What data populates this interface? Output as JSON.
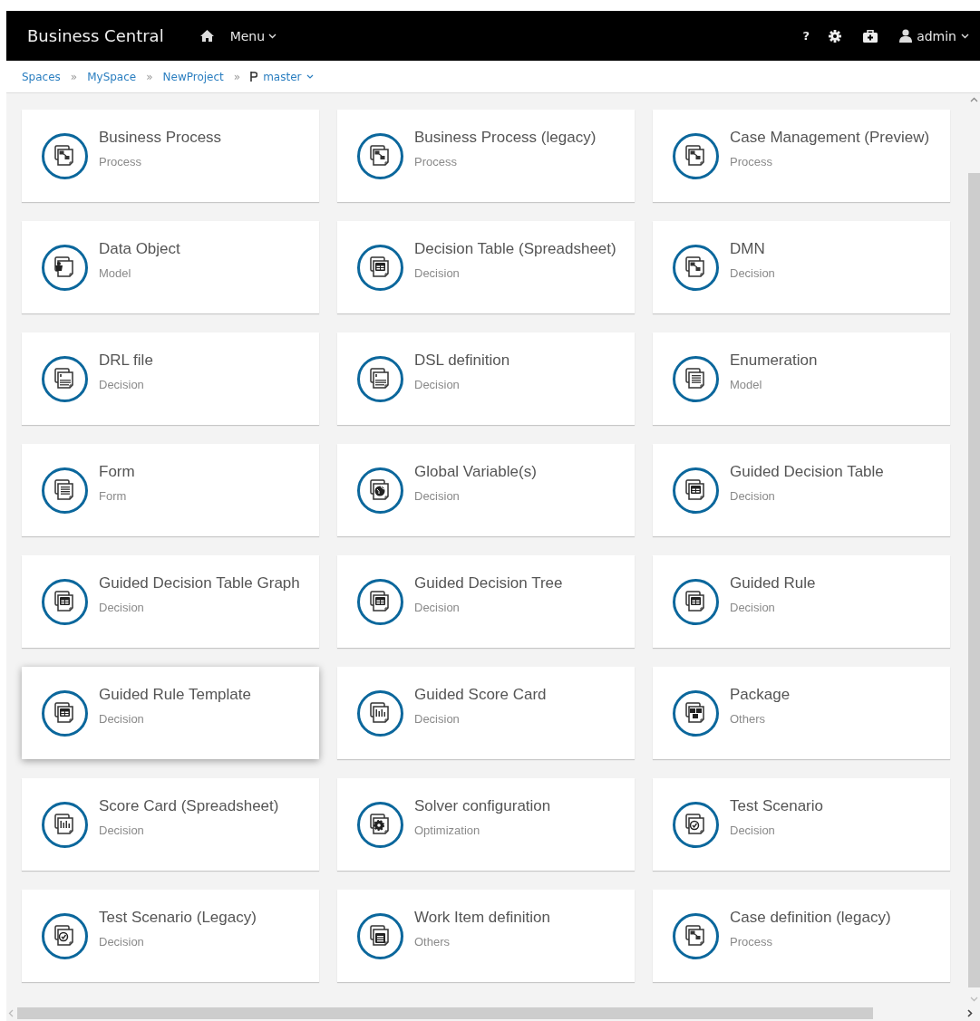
{
  "header": {
    "title": "Business Central",
    "menu": "Menu",
    "help": "?",
    "user": "admin"
  },
  "breadcrumb": {
    "items": [
      {
        "label": "Spaces",
        "separator": "»"
      },
      {
        "label": "MySpace",
        "separator": "»"
      },
      {
        "label": "NewProject",
        "separator": "»"
      }
    ],
    "branch": "master"
  },
  "cards": [
    {
      "title": "Business Process",
      "category": "Process",
      "kind": "process",
      "hovered": false
    },
    {
      "title": "Business Process (legacy)",
      "category": "Process",
      "kind": "process",
      "hovered": false
    },
    {
      "title": "Case Management (Preview)",
      "category": "Process",
      "kind": "process",
      "hovered": false
    },
    {
      "title": "Data Object",
      "category": "Model",
      "kind": "object",
      "hovered": false
    },
    {
      "title": "Decision Table (Spreadsheet)",
      "category": "Decision",
      "kind": "table",
      "hovered": false
    },
    {
      "title": "DMN",
      "category": "Decision",
      "kind": "process",
      "hovered": false
    },
    {
      "title": "DRL file",
      "category": "Decision",
      "kind": "text",
      "hovered": false
    },
    {
      "title": "DSL definition",
      "category": "Decision",
      "kind": "text",
      "hovered": false
    },
    {
      "title": "Enumeration",
      "category": "Model",
      "kind": "list",
      "hovered": false
    },
    {
      "title": "Form",
      "category": "Form",
      "kind": "form",
      "hovered": false
    },
    {
      "title": "Global Variable(s)",
      "category": "Decision",
      "kind": "globe",
      "hovered": false
    },
    {
      "title": "Guided Decision Table",
      "category": "Decision",
      "kind": "table",
      "hovered": false
    },
    {
      "title": "Guided Decision Table Graph",
      "category": "Decision",
      "kind": "table",
      "hovered": false
    },
    {
      "title": "Guided Decision Tree",
      "category": "Decision",
      "kind": "table",
      "hovered": false
    },
    {
      "title": "Guided Rule",
      "category": "Decision",
      "kind": "grid",
      "hovered": false
    },
    {
      "title": "Guided Rule Template",
      "category": "Decision",
      "kind": "grid",
      "hovered": true
    },
    {
      "title": "Guided Score Card",
      "category": "Decision",
      "kind": "score",
      "hovered": false
    },
    {
      "title": "Package",
      "category": "Others",
      "kind": "package",
      "hovered": false
    },
    {
      "title": "Score Card (Spreadsheet)",
      "category": "Decision",
      "kind": "score",
      "hovered": false
    },
    {
      "title": "Solver configuration",
      "category": "Optimization",
      "kind": "gear",
      "hovered": false
    },
    {
      "title": "Test Scenario",
      "category": "Decision",
      "kind": "check",
      "hovered": false
    },
    {
      "title": "Test Scenario (Legacy)",
      "category": "Decision",
      "kind": "check",
      "hovered": false
    },
    {
      "title": "Work Item definition",
      "category": "Others",
      "kind": "workitem",
      "hovered": false
    },
    {
      "title": "Case definition (legacy)",
      "category": "Process",
      "kind": "process",
      "hovered": false
    }
  ]
}
